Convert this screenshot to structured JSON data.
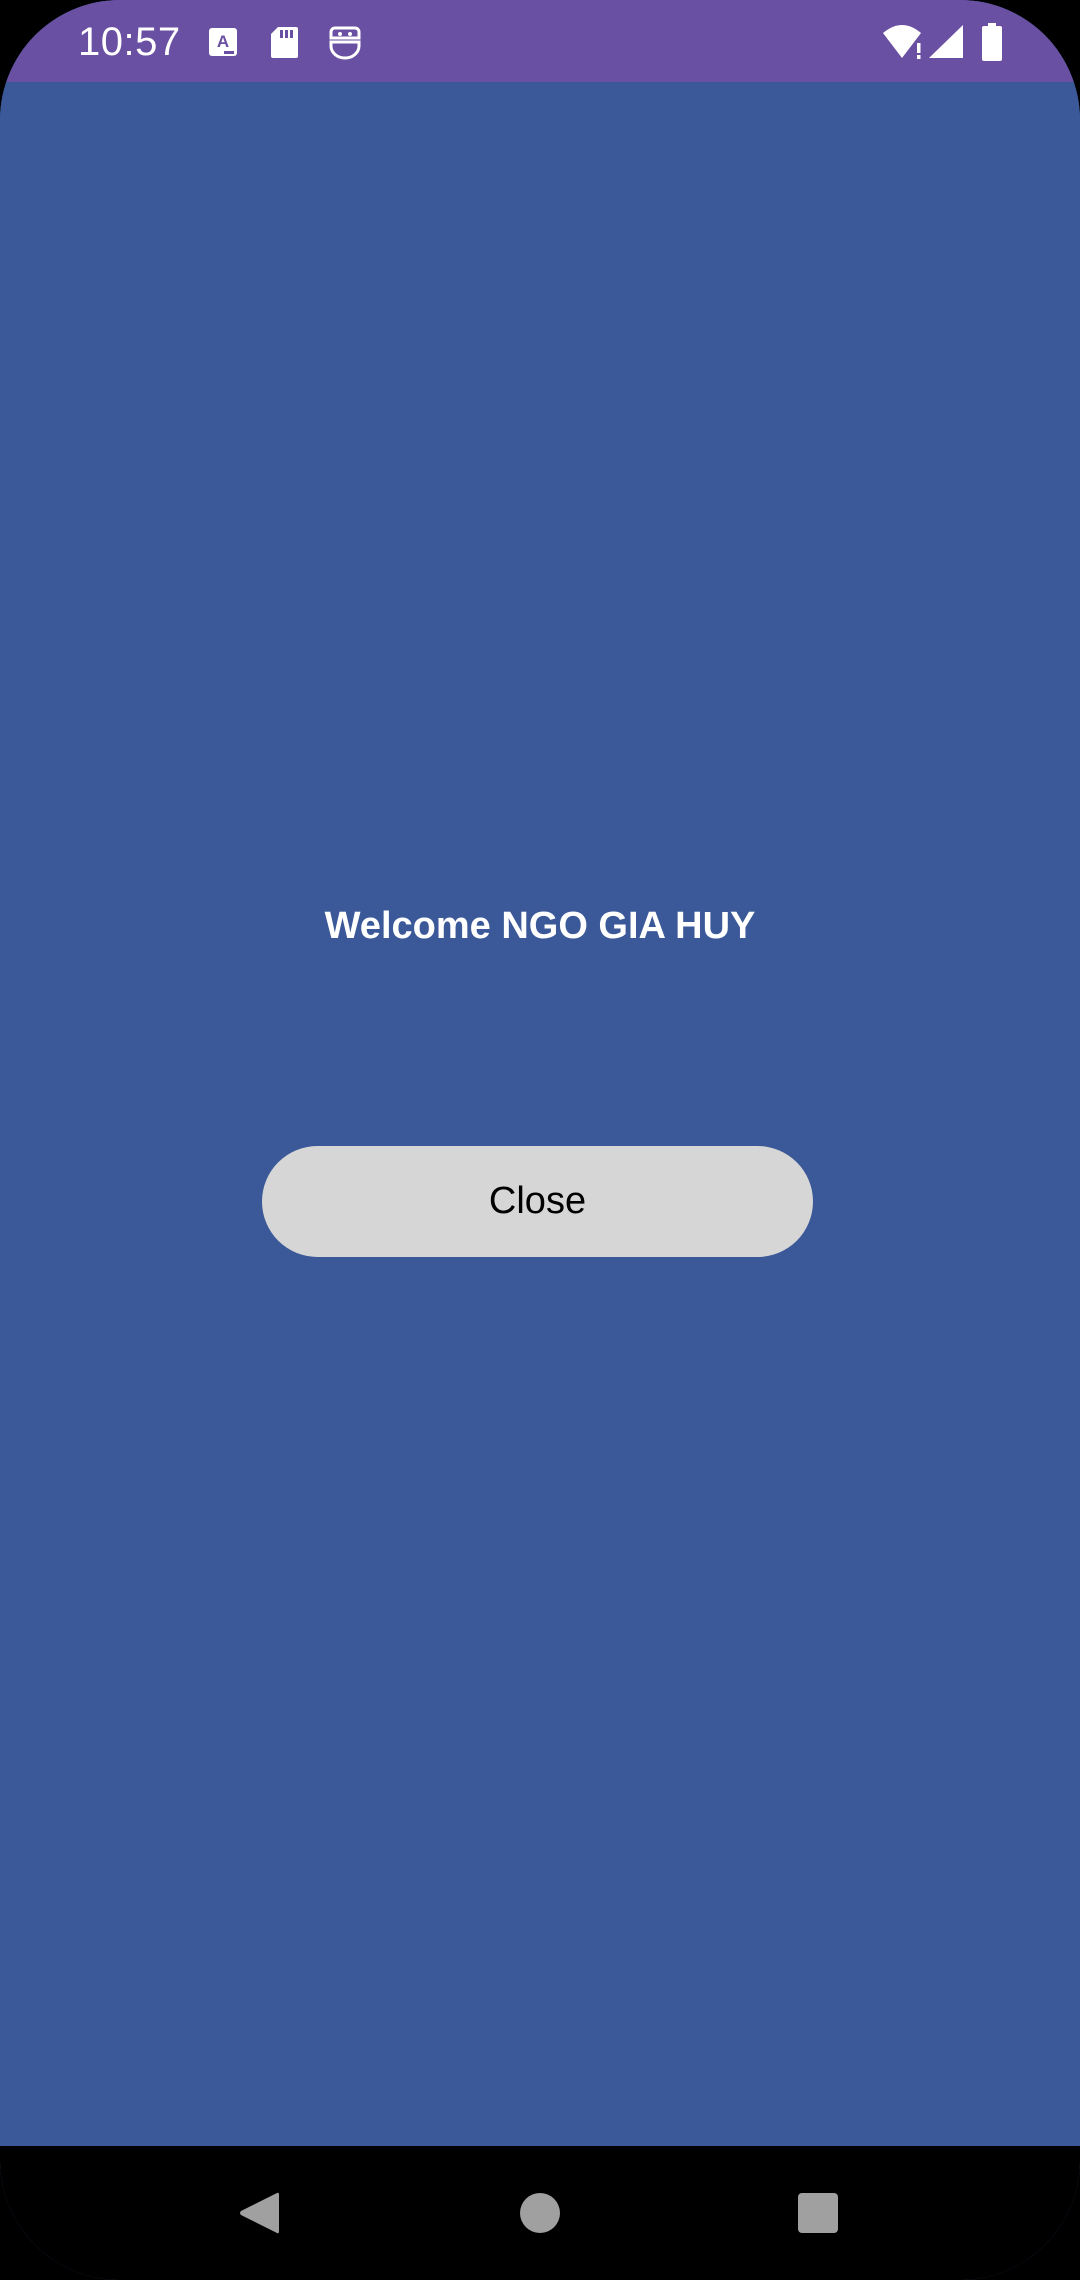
{
  "status_bar": {
    "time": "10:57",
    "background_color": "#6a50a2",
    "left_icons": [
      "a-notification-icon",
      "sd-card-icon",
      "robot-face-icon"
    ],
    "right_icons": [
      "wifi-alert-icon",
      "cellular-signal-icon",
      "battery-icon"
    ]
  },
  "main": {
    "background_color": "#3b5998",
    "welcome_text": "Welcome NGO GIA HUY",
    "close_button_label": "Close"
  },
  "nav_bar": {
    "icons": [
      "back-icon",
      "home-icon",
      "recents-icon"
    ]
  }
}
